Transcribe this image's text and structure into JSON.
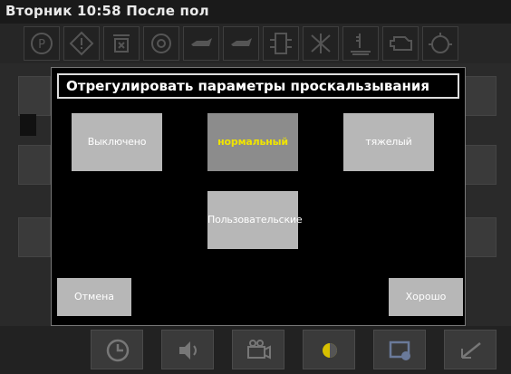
{
  "status_bar": {
    "text": "Вторник 10:58 После пол"
  },
  "warning_icons": [
    "parking-brake-icon",
    "warning-triangle-icon",
    "filter-icon",
    "engine-icon",
    "oil-can-icon",
    "oil-can-icon",
    "hydraulic-icon",
    "transmission-icon",
    "coolant-icon",
    "engine-outline-icon",
    "oil-pressure-icon"
  ],
  "dialog": {
    "title": "Отрегулировать параметры проскальзывания",
    "options": [
      {
        "label": "Выключено"
      },
      {
        "label": "нормальный",
        "selected": true
      },
      {
        "label": "тяжелый"
      },
      {
        "label": "Пользовательские"
      }
    ],
    "cancel_label": "Отмена",
    "ok_label": "Хорошо"
  },
  "bottom_bar": {
    "buttons": [
      "clock-icon",
      "speaker-icon",
      "camera-icon",
      "brightness-icon",
      "display-settings-icon",
      "gauge-icon"
    ]
  },
  "colors": {
    "selected_text": "#f0e400",
    "button_bg": "#b7b7b7",
    "dialog_bg": "#000000"
  }
}
